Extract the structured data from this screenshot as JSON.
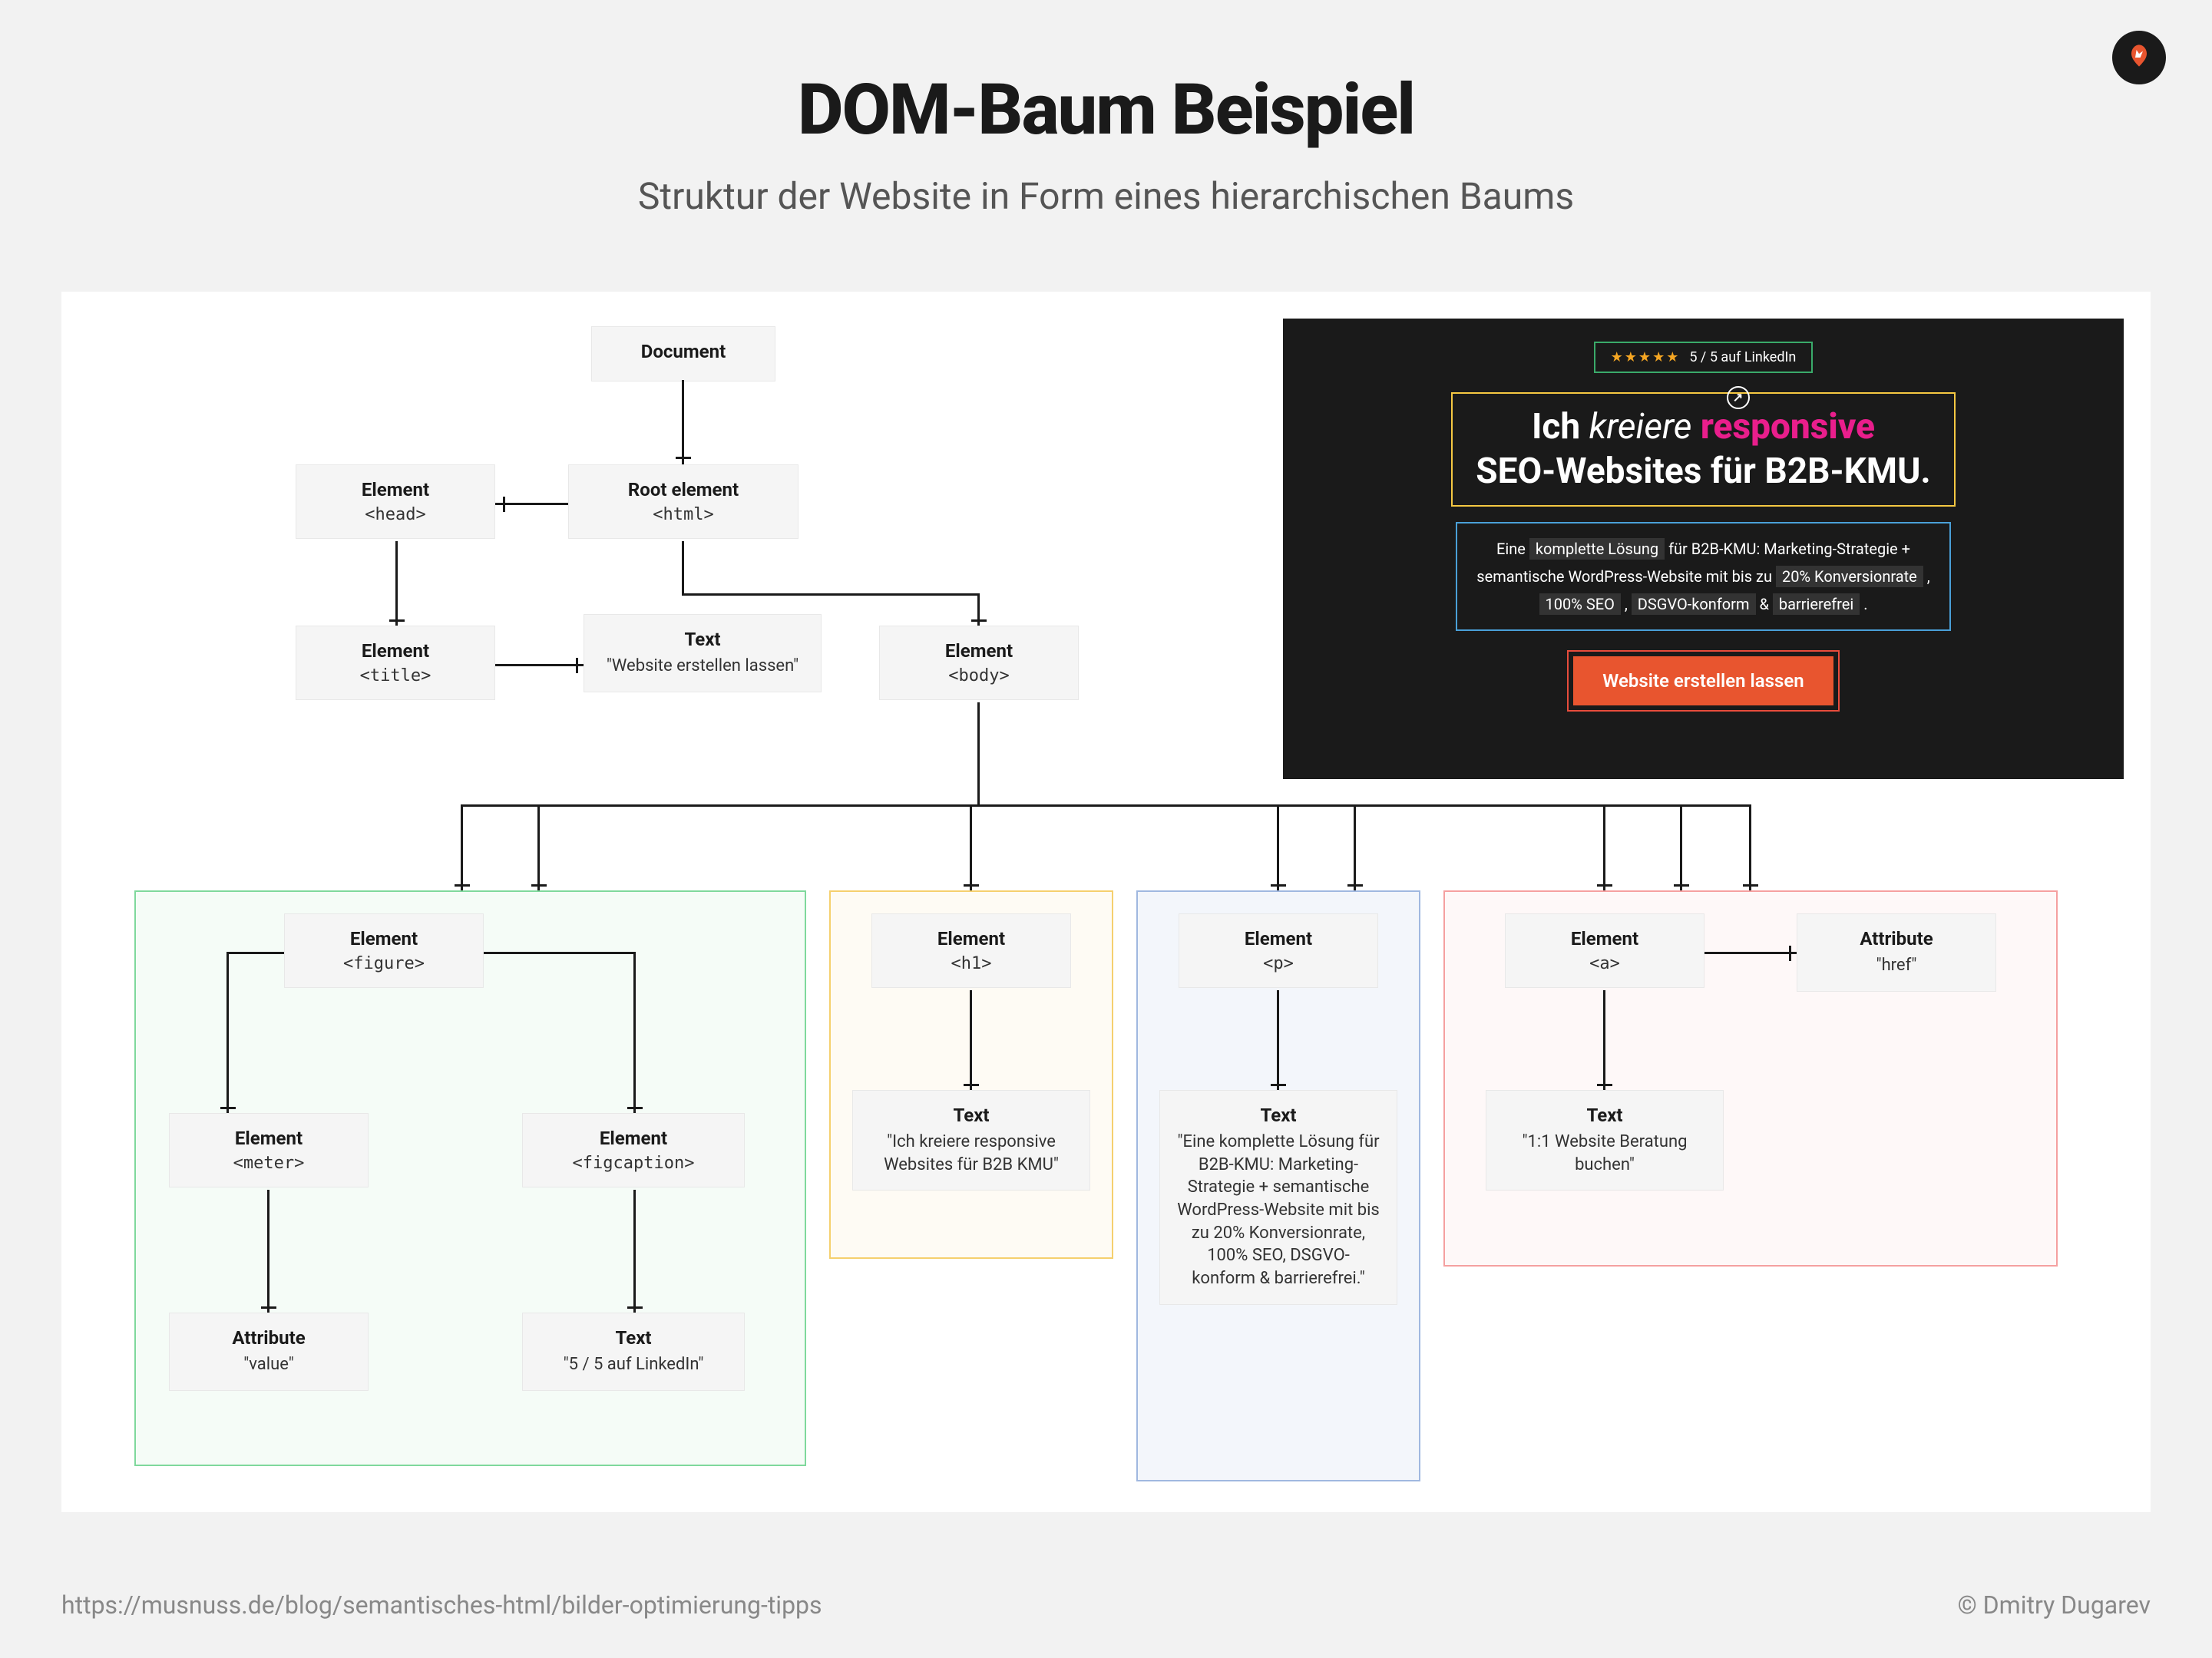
{
  "title": "DOM-Baum Beispiel",
  "subtitle": "Struktur der Website in Form eines hierarchischen Baums",
  "nodes": {
    "document": {
      "type": "Document"
    },
    "root": {
      "type": "Root element",
      "tag": "<html>"
    },
    "head": {
      "type": "Element",
      "tag": "<head>"
    },
    "title_el": {
      "type": "Element",
      "tag": "<title>"
    },
    "title_text": {
      "type": "Text",
      "text": "\"Website erstellen lassen\""
    },
    "body": {
      "type": "Element",
      "tag": "<body>"
    },
    "figure": {
      "type": "Element",
      "tag": "<figure>"
    },
    "meter": {
      "type": "Element",
      "tag": "<meter>"
    },
    "figcaption": {
      "type": "Element",
      "tag": "<figcaption>"
    },
    "attr_value": {
      "type": "Attribute",
      "text": "\"value\""
    },
    "figcap_text": {
      "type": "Text",
      "text": "\"5 / 5 auf LinkedIn\""
    },
    "h1": {
      "type": "Element",
      "tag": "<h1>"
    },
    "h1_text": {
      "type": "Text",
      "text": "\"Ich kreiere responsive Websites für B2B KMU\""
    },
    "p": {
      "type": "Element",
      "tag": "<p>"
    },
    "p_text": {
      "type": "Text",
      "text": "\"Eine komplette Lösung für B2B-KMU: Marketing-Strategie + semantische WordPress-Website mit bis zu 20% Konversionrate, 100% SEO, DSGVO-konform & barrierefrei.\""
    },
    "a": {
      "type": "Element",
      "tag": "<a>"
    },
    "attr_href": {
      "type": "Attribute",
      "text": "\"href\""
    },
    "a_text": {
      "type": "Text",
      "text": "\"1:1 Website Beratung buchen\""
    }
  },
  "preview": {
    "rating": "5 / 5 auf LinkedIn",
    "stars": "★★★★★",
    "h1_prefix": "Ich ",
    "h1_kreiere": "kreiere",
    "h1_responsive": "responsive",
    "h1_line2": "SEO-Websites für B2B-KMU.",
    "p1": "Eine",
    "hl1": "komplette Lösung",
    "p2": "für B2B-KMU: Marketing-Strategie +",
    "p3": "semantische WordPress-Website mit bis zu",
    "hl2": "20% Konversionrate",
    "hl3": "100% SEO",
    "hl4": "DSGVO-konform",
    "amp": "&",
    "hl5": "barrierefrei",
    "dot": ".",
    "comma": ",",
    "btn": "Website erstellen lassen"
  },
  "footer": {
    "url": "https://musnuss.de/blog/semantisches-html/bilder-optimierung-tipps",
    "credit": "© Dmitry Dugarev"
  }
}
